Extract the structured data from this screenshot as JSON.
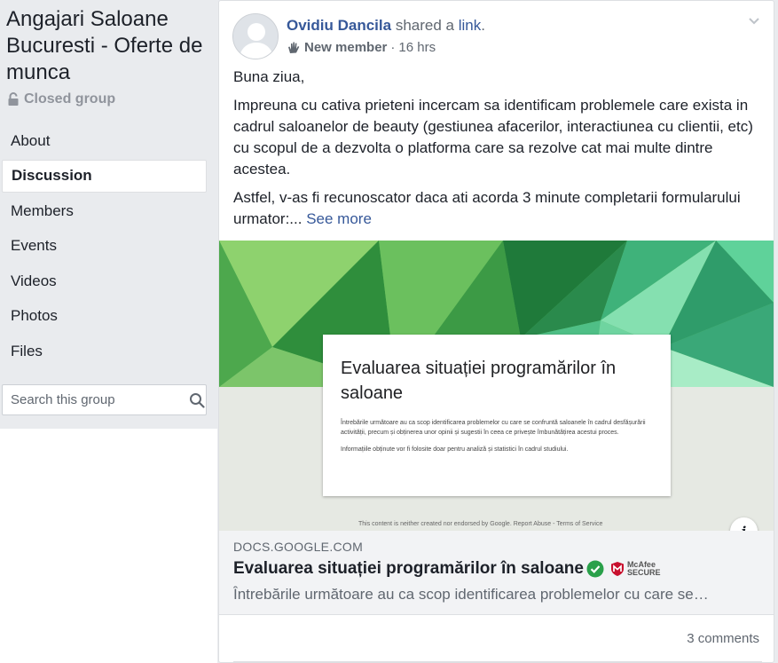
{
  "group": {
    "title": "Angajari Saloane Bucuresti - Oferte de munca",
    "privacy": "Closed group",
    "nav": [
      {
        "label": "About"
      },
      {
        "label": "Discussion"
      },
      {
        "label": "Members"
      },
      {
        "label": "Events"
      },
      {
        "label": "Videos"
      },
      {
        "label": "Photos"
      },
      {
        "label": "Files"
      }
    ],
    "active_nav": "Discussion",
    "search_placeholder": "Search this group"
  },
  "post": {
    "author": "Ovidiu Dancila",
    "action_prefix": "shared a",
    "action_link": "link",
    "action_suffix": ".",
    "badge": "New member",
    "separator": "·",
    "time": "16 hrs",
    "paragraphs": [
      "Buna ziua,",
      "Impreuna cu cativa prieteni incercam sa identificam problemele care exista in cadrul saloanelor de beauty (gestiunea afacerilor, interactiunea cu clientii, etc) cu scopul de a dezvolta o platforma care sa rezolve cat mai multe dintre acestea.",
      "Astfel, v-as fi recunoscator daca ati acorda 3 minute completarii formularului urmator:..."
    ],
    "see_more": "See more",
    "preview": {
      "doc_title": "Evaluarea situației programărilor în saloane",
      "doc_body_1": "Întrebările următoare au ca scop identificarea problemelor cu care se confruntă saloanele în cadrul desfășurării activității, precum și obținerea unor opinii și sugestii în ceea ce privește îmbunătățirea acestui proces.",
      "doc_body_2": "Informațiile obținute vor fi folosite doar pentru analiză și statistici în cadrul studiului.",
      "doc_footer": "This content is neither created nor endorsed by Google. Report Abuse - Terms of Service",
      "info_label": "i"
    },
    "link": {
      "domain": "DOCS.GOOGLE.COM",
      "title": "Evaluarea situației programărilor în saloane",
      "mcafee_line1": "McAfee",
      "mcafee_line2": "SECURE",
      "description": "Întrebările următoare au ca scop identificarea problemelor cu care se…"
    },
    "comments": "3 comments"
  },
  "colors": {
    "link_blue": "#365899",
    "verified_green": "#2aa04a",
    "mcafee_red": "#c8102e"
  }
}
